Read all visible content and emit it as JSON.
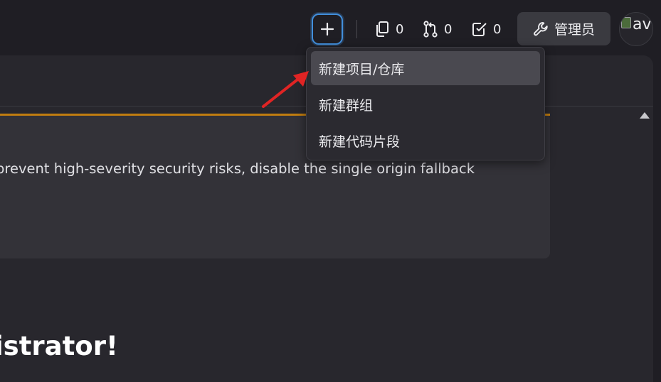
{
  "topbar": {
    "counters": [
      {
        "icon": "copy-icon",
        "value": "0"
      },
      {
        "icon": "merge-request-icon",
        "value": "0"
      },
      {
        "icon": "todo-check-icon",
        "value": "0"
      }
    ],
    "admin_label": "管理员",
    "avatar_alt": "av"
  },
  "dropdown": {
    "items": [
      {
        "label": "新建项目/仓库"
      },
      {
        "label": "新建群组"
      },
      {
        "label": "新建代码片段"
      }
    ]
  },
  "alert": {
    "text": "prevent high-severity security risks, disable the single origin fallback",
    "accent": "#c17d10"
  },
  "welcome": {
    "text": "istrator!"
  },
  "colors": {
    "focus_ring": "#428fdc",
    "annotation_arrow": "#e02424"
  }
}
